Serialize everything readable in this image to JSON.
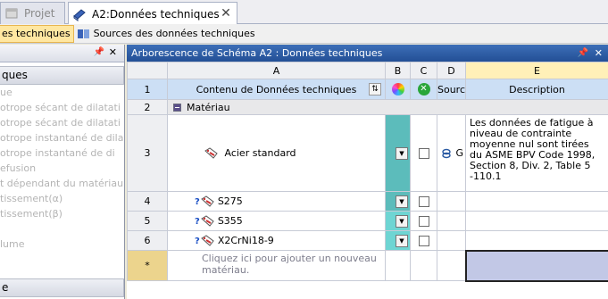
{
  "tabs": [
    {
      "label": "Projet",
      "icon": "project-icon"
    },
    {
      "label": "A2:Données techniques",
      "icon": "books-icon"
    }
  ],
  "toolbar": {
    "btn1": "es techniques",
    "btn2": "Sources des données techniques"
  },
  "left_panel": {
    "category_top": "ques",
    "items": [
      "ue",
      "otrope sécant de dilatati",
      "otrope sécant de dilatati",
      "otrope instantané de dila",
      "otrope instantané de di",
      "efusion",
      "t dépendant du matériau",
      "tissement(α)",
      "tissement(β)",
      "",
      "lume"
    ],
    "category_bottom": "e"
  },
  "main_panel": {
    "title": "Arborescence de Schéma A2 : Données techniques",
    "columns": [
      "A",
      "B",
      "C",
      "D",
      "E"
    ],
    "field_headers": {
      "a": "Contenu de Données techniques",
      "d": "Source",
      "e": "Description"
    },
    "rows": [
      {
        "num": "1"
      },
      {
        "num": "2",
        "group": "Matériau"
      },
      {
        "num": "3",
        "name": "Acier standard",
        "source": "G",
        "description": "Les données de fatigue à niveau de contrainte moyenne nul sont tirées du ASME BPV Code 1998, Section 8, Div. 2, Table 5 -110.1"
      },
      {
        "num": "4",
        "name": "S275",
        "source": "",
        "description": ""
      },
      {
        "num": "5",
        "name": "S355",
        "source": "",
        "description": ""
      },
      {
        "num": "6",
        "name": "X2CrNi18-9",
        "source": "",
        "description": ""
      }
    ],
    "new_row": {
      "num": "*",
      "placeholder": "Cliquez ici pour ajouter un nouveau matériau."
    }
  },
  "colors": {
    "title_bar": "#2a5aa3",
    "selected_column": "#fff0b8",
    "b_column": "#5cbcbb",
    "selected_cell": "#c2c8e6"
  }
}
